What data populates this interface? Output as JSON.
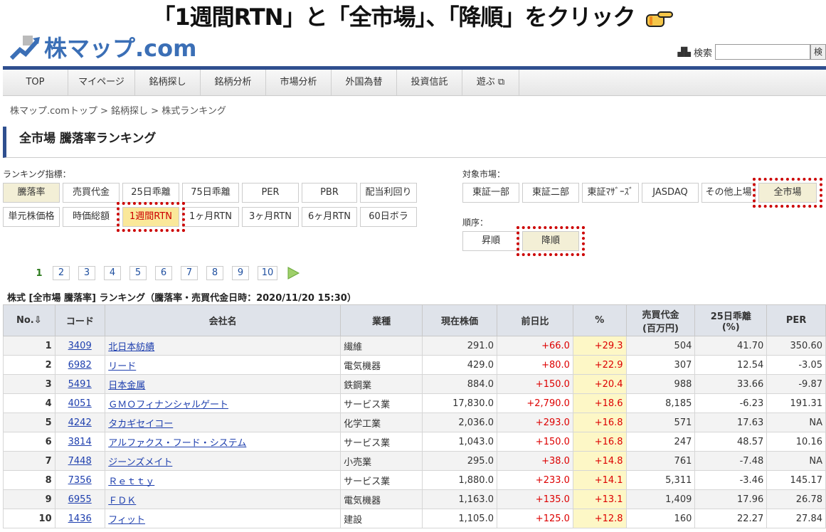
{
  "instruction": {
    "text": "「1週間RTN」と「全市場」、「降順」をクリック"
  },
  "header": {
    "logo_text": "株マップ.com",
    "search_label": "検索",
    "search_button": "検",
    "search_placeholder": ""
  },
  "nav": [
    {
      "label": "TOP"
    },
    {
      "label": "マイページ"
    },
    {
      "label": "銘柄探し"
    },
    {
      "label": "銘柄分析"
    },
    {
      "label": "市場分析"
    },
    {
      "label": "外国為替"
    },
    {
      "label": "投資信託"
    },
    {
      "label": "遊ぶ ⧉"
    }
  ],
  "breadcrumb": "株マップ.comトップ > 銘柄探し > 株式ランキング",
  "page_title": "全市場 騰落率ランキング",
  "indicator": {
    "label": "ランキング指標：",
    "row1": [
      "騰落率",
      "売買代金",
      "25日乖離",
      "75日乖離",
      "PER",
      "PBR",
      "配当利回り"
    ],
    "row2": [
      "単元株価格",
      "時価総額",
      "1週間RTN",
      "1ヶ月RTN",
      "3ヶ月RTN",
      "6ヶ月RTN",
      "60日ボラ"
    ]
  },
  "market": {
    "label": "対象市場：",
    "items": [
      "東証一部",
      "東証二部",
      "東証ﾏｻﾞｰｽﾞ",
      "JASDAQ",
      "その他上場",
      "全市場"
    ]
  },
  "order": {
    "label": "順序：",
    "items": [
      "昇順",
      "降順"
    ]
  },
  "pager": {
    "current": "1",
    "pages": [
      "2",
      "3",
      "4",
      "5",
      "6",
      "7",
      "8",
      "9",
      "10"
    ]
  },
  "caption": "株式 [全市場 騰落率] ランキング（騰落率・売買代金日時：2020/11/20 15:30）",
  "table": {
    "headers": {
      "no": "No.⇩",
      "code": "コード",
      "name": "会社名",
      "sector": "業種",
      "price": "現在株価",
      "change": "前日比",
      "pct": "%",
      "volume": "売買代金",
      "volume_unit": "(百万円)",
      "dev": "25日乖離",
      "dev_unit": "(%)",
      "per": "PER"
    },
    "rows": [
      {
        "no": "1",
        "code": "3409",
        "name": "北日本紡績",
        "sector": "繊維",
        "price": "291.0",
        "change": "+66.0",
        "pct": "+29.3",
        "volume": "504",
        "dev": "41.70",
        "per": "350.60"
      },
      {
        "no": "2",
        "code": "6982",
        "name": "リード",
        "sector": "電気機器",
        "price": "429.0",
        "change": "+80.0",
        "pct": "+22.9",
        "volume": "307",
        "dev": "12.54",
        "per": "-3.05"
      },
      {
        "no": "3",
        "code": "5491",
        "name": "日本金属",
        "sector": "鉄鋼業",
        "price": "884.0",
        "change": "+150.0",
        "pct": "+20.4",
        "volume": "988",
        "dev": "33.66",
        "per": "-9.87"
      },
      {
        "no": "4",
        "code": "4051",
        "name": "ＧＭＯフィナンシャルゲート",
        "sector": "サービス業",
        "price": "17,830.0",
        "change": "+2,790.0",
        "pct": "+18.6",
        "volume": "8,185",
        "dev": "-6.23",
        "per": "191.31"
      },
      {
        "no": "5",
        "code": "4242",
        "name": "タカギセイコー",
        "sector": "化学工業",
        "price": "2,036.0",
        "change": "+293.0",
        "pct": "+16.8",
        "volume": "571",
        "dev": "17.63",
        "per": "NA"
      },
      {
        "no": "6",
        "code": "3814",
        "name": "アルファクス・フード・システム",
        "sector": "サービス業",
        "price": "1,043.0",
        "change": "+150.0",
        "pct": "+16.8",
        "volume": "247",
        "dev": "48.57",
        "per": "10.16"
      },
      {
        "no": "7",
        "code": "7448",
        "name": "ジーンズメイト",
        "sector": "小売業",
        "price": "295.0",
        "change": "+38.0",
        "pct": "+14.8",
        "volume": "761",
        "dev": "-7.48",
        "per": "NA"
      },
      {
        "no": "8",
        "code": "7356",
        "name": "Ｒｅｔｔｙ",
        "sector": "サービス業",
        "price": "1,880.0",
        "change": "+233.0",
        "pct": "+14.1",
        "volume": "5,311",
        "dev": "-3.46",
        "per": "145.17"
      },
      {
        "no": "9",
        "code": "6955",
        "name": "ＦＤＫ",
        "sector": "電気機器",
        "price": "1,163.0",
        "change": "+135.0",
        "pct": "+13.1",
        "volume": "1,409",
        "dev": "17.96",
        "per": "26.78"
      },
      {
        "no": "10",
        "code": "1436",
        "name": "フィット",
        "sector": "建設",
        "price": "1,105.0",
        "change": "+125.0",
        "pct": "+12.8",
        "volume": "160",
        "dev": "22.27",
        "per": "27.84"
      }
    ]
  }
}
